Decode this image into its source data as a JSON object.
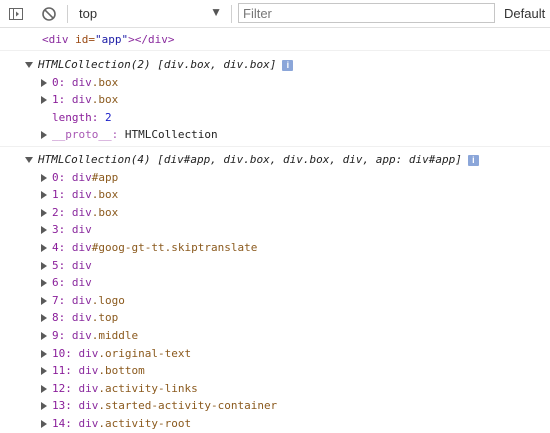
{
  "toolbar": {
    "context_value": "top",
    "filter_placeholder": "Filter",
    "levels_label": "Default"
  },
  "console": {
    "message1": {
      "tag_open": "<div",
      "attr_name": " id=",
      "attr_value": "\"app\"",
      "tag_close": "></div>"
    },
    "group1": {
      "summary": "HTMLCollection(2) [div.box, div.box]",
      "items": [
        {
          "key": "0:",
          "node": " div",
          "cls": ".box"
        },
        {
          "key": "1:",
          "node": " div",
          "cls": ".box"
        }
      ],
      "length_key": "length:",
      "length_value": "2",
      "proto_key": "__proto__:",
      "proto_value": " HTMLCollection"
    },
    "group2": {
      "summary": "HTMLCollection(4) [div#app, div.box, div.box, div, app: div#app]",
      "items": [
        {
          "key": "0:",
          "node": " div",
          "cls": "#app"
        },
        {
          "key": "1:",
          "node": " div",
          "cls": ".box"
        },
        {
          "key": "2:",
          "node": " div",
          "cls": ".box"
        },
        {
          "key": "3:",
          "node": " div",
          "cls": ""
        },
        {
          "key": "4:",
          "node": " div",
          "cls": "#goog-gt-tt.skiptranslate"
        },
        {
          "key": "5:",
          "node": " div",
          "cls": ""
        },
        {
          "key": "6:",
          "node": " div",
          "cls": ""
        },
        {
          "key": "7:",
          "node": " div",
          "cls": ".logo"
        },
        {
          "key": "8:",
          "node": " div",
          "cls": ".top"
        },
        {
          "key": "9:",
          "node": " div",
          "cls": ".middle"
        },
        {
          "key": "10:",
          "node": " div",
          "cls": ".original-text"
        },
        {
          "key": "11:",
          "node": " div",
          "cls": ".bottom"
        },
        {
          "key": "12:",
          "node": " div",
          "cls": ".activity-links"
        },
        {
          "key": "13:",
          "node": " div",
          "cls": ".started-activity-container"
        },
        {
          "key": "14:",
          "node": " div",
          "cls": ".activity-root"
        }
      ]
    }
  }
}
